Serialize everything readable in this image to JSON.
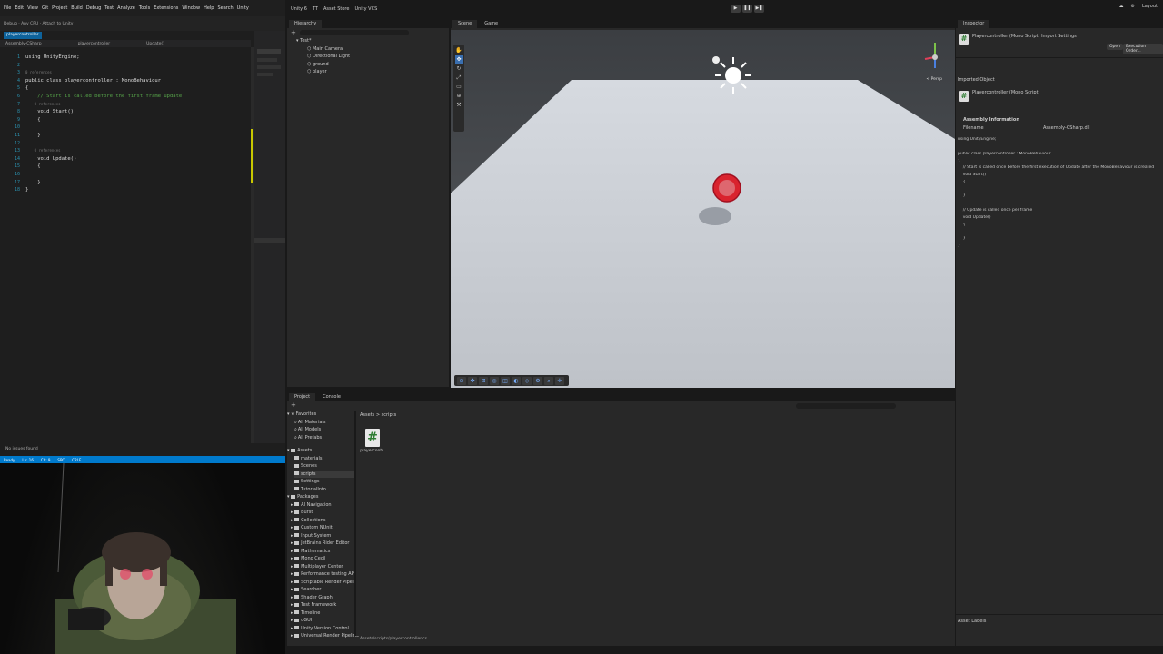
{
  "vs": {
    "menu_items": [
      "File",
      "Edit",
      "View",
      "Git",
      "Project",
      "Build",
      "Debug",
      "Test",
      "Analyze",
      "Tools",
      "Extensions",
      "Window",
      "Help",
      "Search",
      "Unity"
    ],
    "toolbar_text": "Debug · Any CPU · Attach to Unity",
    "tab_label": "playercontroller",
    "nav": [
      "Assembly-CSharp",
      "playercontroller",
      "Update()"
    ],
    "code_lines": [
      {
        "n": "1",
        "text": "using UnityEngine;",
        "cls": ""
      },
      {
        "n": "2",
        "text": "",
        "cls": ""
      },
      {
        "n": "3",
        "text": "0 references",
        "cls": "hint"
      },
      {
        "n": "4",
        "text": "public class playercontroller : MonoBehaviour",
        "cls": ""
      },
      {
        "n": "5",
        "text": "{",
        "cls": ""
      },
      {
        "n": "6",
        "text": "    // Start is called before the first frame update",
        "cls": "cm"
      },
      {
        "n": "7",
        "text": "    0 references",
        "cls": "hint"
      },
      {
        "n": "8",
        "text": "    void Start()",
        "cls": ""
      },
      {
        "n": "9",
        "text": "    {",
        "cls": ""
      },
      {
        "n": "10",
        "text": "",
        "cls": ""
      },
      {
        "n": "11",
        "text": "    }",
        "cls": ""
      },
      {
        "n": "12",
        "text": "",
        "cls": ""
      },
      {
        "n": "13",
        "text": "    0 references",
        "cls": "hint"
      },
      {
        "n": "14",
        "text": "    void Update()",
        "cls": ""
      },
      {
        "n": "15",
        "text": "    {",
        "cls": ""
      },
      {
        "n": "16",
        "text": "",
        "cls": ""
      },
      {
        "n": "17",
        "text": "    }",
        "cls": ""
      },
      {
        "n": "18",
        "text": "}",
        "cls": ""
      }
    ],
    "status_text": "No issues found",
    "blue_bar": [
      "Ready",
      "Ln: 16",
      "Ch: 9",
      "SPC",
      "CRLF"
    ]
  },
  "unity": {
    "top_buttons": [
      "Unity 6",
      "TT",
      "Asset Store",
      "Unity VCS"
    ],
    "play_icons": [
      "▶",
      "❚❚",
      "▶❚"
    ],
    "top_right": [
      "☁",
      "⚙",
      "Layout"
    ],
    "hierarchy": {
      "tab": "Hierarchy",
      "items": [
        "Main Camera",
        "Directional Light",
        "ground",
        "player"
      ],
      "scene_name": "Test*"
    },
    "scene": {
      "tabs": [
        "Scene",
        "Game"
      ],
      "persp": "< Persp"
    },
    "inspector": {
      "tab": "Inspector",
      "title": "Playercontroller (Mono Script) Import Settings",
      "open_btn": "Open",
      "exec_btn": "Execution Order...",
      "imported_object": "Imported Object",
      "object_name": "Playercontroller (Mono Script)",
      "assembly_info": "Assembly Information",
      "filename_label": "Filename",
      "filename_value": "Assembly-CSharp.dll",
      "preview_lines": [
        "using UnityEngine;",
        "",
        "public class playercontroller : MonoBehaviour",
        "{",
        "    // Start is called once before the first execution of Update after the MonoBehaviour is created",
        "    void Start()",
        "    {",
        "",
        "    }",
        "",
        "    // Update is called once per frame",
        "    void Update()",
        "    {",
        "",
        "    }",
        "}"
      ],
      "asset_labels": "Asset Labels"
    },
    "project": {
      "tabs": [
        "Project",
        "Console"
      ],
      "favorites_label": "Favorites",
      "favorites": [
        "All Materials",
        "All Models",
        "All Prefabs"
      ],
      "assets_label": "Assets",
      "asset_folders": [
        "materials",
        "Scenes",
        "scripts",
        "Settings",
        "TutorialInfo"
      ],
      "packages_label": "Packages",
      "packages": [
        "AI Navigation",
        "Burst",
        "Collections",
        "Custom NUnit",
        "Input System",
        "JetBrains Rider Editor",
        "Mathematics",
        "Mono Cecil",
        "Multiplayer Center",
        "Performance testing API",
        "Scriptable Render Pipeline",
        "Searcher",
        "Shader Graph",
        "Test Framework",
        "Timeline",
        "uGUI",
        "Unity Version Control",
        "Universal Render Pipeline"
      ],
      "breadcrumb": "Assets > scripts",
      "asset_name": "playercontr...",
      "status_path": "Assets/scripts/playercontroller.cs"
    }
  }
}
